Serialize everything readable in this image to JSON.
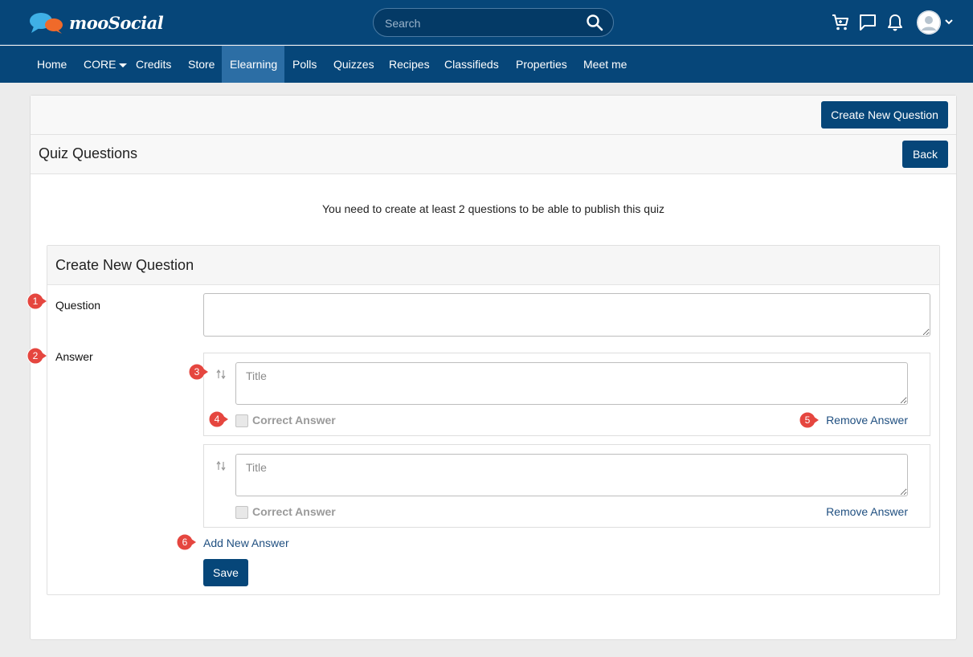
{
  "brand": {
    "name": "mooSocial"
  },
  "search": {
    "placeholder": "Search"
  },
  "nav": {
    "items": [
      {
        "label": "Home"
      },
      {
        "label": "CORE"
      },
      {
        "label": "Credits"
      },
      {
        "label": "Store"
      },
      {
        "label": "Elearning"
      },
      {
        "label": "Polls"
      },
      {
        "label": "Quizzes"
      },
      {
        "label": "Recipes"
      },
      {
        "label": "Classifieds"
      },
      {
        "label": "Properties"
      },
      {
        "label": "Meet me"
      }
    ],
    "active": "Elearning"
  },
  "header": {
    "create_button": "Create New Question",
    "title": "Quiz Questions",
    "back_button": "Back"
  },
  "notice": "You need to create at least 2 questions to be able to publish this quiz",
  "form": {
    "title": "Create New Question",
    "question_label": "Question",
    "answer_label": "Answer",
    "answers": [
      {
        "placeholder": "Title",
        "correct_label": "Correct Answer",
        "remove_label": "Remove Answer"
      },
      {
        "placeholder": "Title",
        "correct_label": "Correct Answer",
        "remove_label": "Remove Answer"
      }
    ],
    "add_answer": "Add New Answer",
    "save_button": "Save"
  },
  "markers": [
    "1",
    "2",
    "3",
    "4",
    "5",
    "6"
  ],
  "colors": {
    "brand": "#064679",
    "active_nav": "#2c6ea5",
    "marker": "#e5463f",
    "link": "#1f4f80"
  }
}
